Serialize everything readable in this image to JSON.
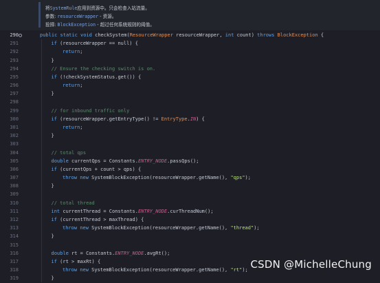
{
  "doc_comment": {
    "line1_prefix": "将",
    "line1_code": "SystemRule",
    "line1_suffix": "应用到资源中。只会检查入站流量。",
    "line2_prefix": "参数:",
    "line2_code": "resourceWrapper",
    "line2_suffix": " - 资源。",
    "line3_prefix": "投掷:",
    "line3_code": "BlockException",
    "line3_suffix": " - 超过任何系统规则的阈值。"
  },
  "lines": [
    {
      "num": "290",
      "text": "public static void checkSystem(ResourceWrapper resourceWrapper, int count) throws BlockException {"
    },
    {
      "num": "291",
      "text": "if (resourceWrapper == null) {"
    },
    {
      "num": "292",
      "text": "return;"
    },
    {
      "num": "293",
      "text": "}"
    },
    {
      "num": "294",
      "text": "// Ensure the checking switch is on."
    },
    {
      "num": "295",
      "text": "if (!checkSystemStatus.get()) {"
    },
    {
      "num": "296",
      "text": "return;"
    },
    {
      "num": "297",
      "text": "}"
    },
    {
      "num": "298",
      "text": ""
    },
    {
      "num": "299",
      "text": "// for inbound traffic only"
    },
    {
      "num": "300",
      "text": "if (resourceWrapper.getEntryType() != EntryType.IN) {"
    },
    {
      "num": "301",
      "text": "return;"
    },
    {
      "num": "302",
      "text": "}"
    },
    {
      "num": "303",
      "text": ""
    },
    {
      "num": "304",
      "text": "// total qps"
    },
    {
      "num": "305",
      "text": "double currentQps = Constants.ENTRY_NODE.passQps();"
    },
    {
      "num": "306",
      "text": "if (currentQps + count > qps) {"
    },
    {
      "num": "307",
      "text": "throw new SystemBlockException(resourceWrapper.getName(), \"qps\");"
    },
    {
      "num": "308",
      "text": "}"
    },
    {
      "num": "309",
      "text": ""
    },
    {
      "num": "310",
      "text": "// total thread"
    },
    {
      "num": "311",
      "text": "int currentThread = Constants.ENTRY_NODE.curThreadNum();"
    },
    {
      "num": "312",
      "text": "if (currentThread > maxThread) {"
    },
    {
      "num": "313",
      "text": "throw new SystemBlockException(resourceWrapper.getName(), \"thread\");"
    },
    {
      "num": "314",
      "text": "}"
    },
    {
      "num": "315",
      "text": ""
    },
    {
      "num": "316",
      "text": "double rt = Constants.ENTRY_NODE.avgRt();"
    },
    {
      "num": "317",
      "text": "if (rt > maxRt) {"
    },
    {
      "num": "318",
      "text": "throw new SystemBlockException(resourceWrapper.getName(), \"rt\");"
    },
    {
      "num": "319",
      "text": "}"
    }
  ],
  "watermark": "CSDN @MichelleChung"
}
